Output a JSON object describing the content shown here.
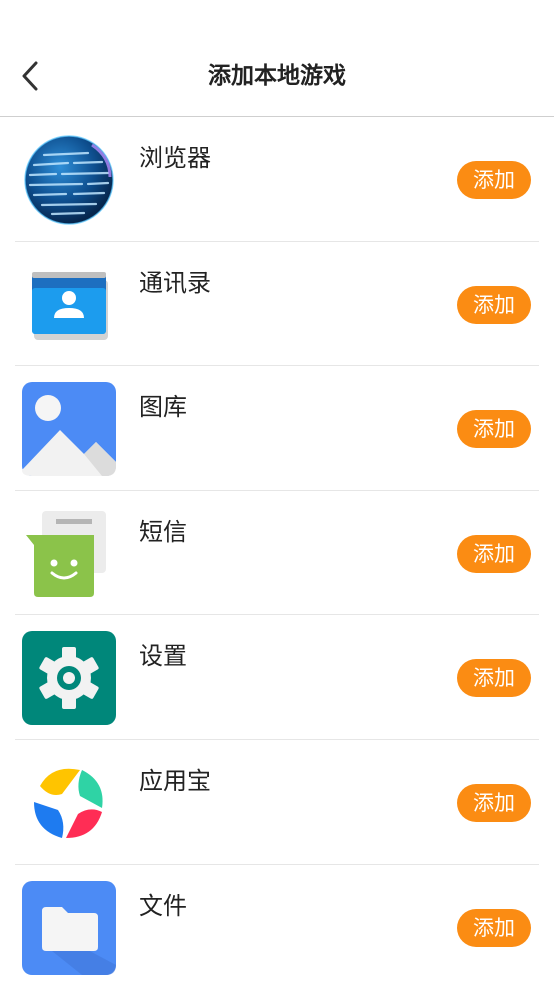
{
  "header": {
    "title": "添加本地游戏",
    "back_icon": "chevron-left-icon"
  },
  "colors": {
    "accent": "#fb8c13",
    "divider": "#e6e6e6",
    "text": "#222222"
  },
  "apps": [
    {
      "name": "浏览器",
      "icon": "globe-icon",
      "add_label": "添加"
    },
    {
      "name": "通讯录",
      "icon": "contacts-icon",
      "add_label": "添加"
    },
    {
      "name": "图库",
      "icon": "gallery-icon",
      "add_label": "添加"
    },
    {
      "name": "短信",
      "icon": "messages-icon",
      "add_label": "添加"
    },
    {
      "name": "设置",
      "icon": "settings-gear-icon",
      "add_label": "添加"
    },
    {
      "name": "应用宝",
      "icon": "app-store-icon",
      "add_label": "添加"
    },
    {
      "name": "文件",
      "icon": "folder-icon",
      "add_label": "添加"
    }
  ]
}
